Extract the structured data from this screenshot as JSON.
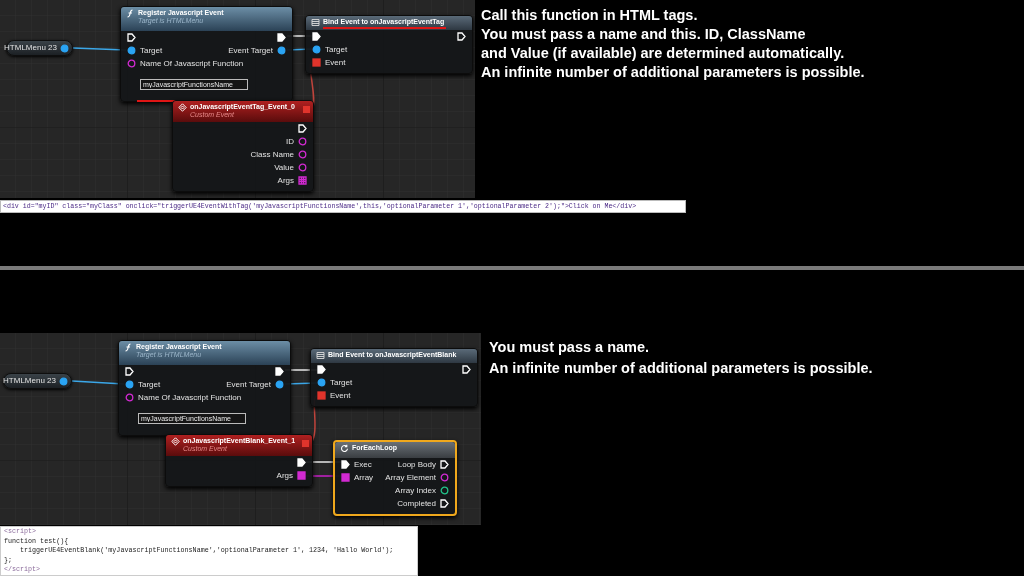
{
  "sections": [
    {
      "graph": {
        "nodes": [
          {
            "kind": "variable",
            "title": "HTMLMenu 23"
          },
          {
            "kind": "function",
            "title": "Register Javascript Event",
            "subtitle": "Target is HTMLMenu",
            "rows": [
              {
                "in": {
                  "kind": "exec",
                  "connected": false
                },
                "out": {
                  "kind": "exec",
                  "connected": true
                }
              },
              {
                "in": {
                  "kind": "object",
                  "label": "Target",
                  "connected": true
                },
                "out": {
                  "kind": "object",
                  "label": "Event Target",
                  "connected": true
                }
              },
              {
                "in": {
                  "kind": "string",
                  "label": "Name Of Javascript Function",
                  "connected": false,
                  "value": "myJavascriptFunctionsName",
                  "highlighted": true
                }
              }
            ]
          },
          {
            "kind": "bind",
            "title": "Bind Event to onJavascriptEventTag",
            "highlighted": true,
            "rows": [
              {
                "in": {
                  "kind": "exec",
                  "connected": true
                },
                "out": {
                  "kind": "exec",
                  "connected": false
                }
              },
              {
                "in": {
                  "kind": "object",
                  "label": "Target",
                  "connected": true
                }
              },
              {
                "in": {
                  "kind": "delegate",
                  "label": "Event",
                  "connected": true
                }
              }
            ]
          },
          {
            "kind": "event",
            "title": "onJavascriptEventTag_Event_0",
            "subtitle": "Custom Event",
            "rows": [
              {
                "out": {
                  "kind": "exec",
                  "connected": false
                }
              },
              {
                "out": {
                  "kind": "string",
                  "label": "ID",
                  "connected": false
                }
              },
              {
                "out": {
                  "kind": "string",
                  "label": "Class Name",
                  "connected": false
                }
              },
              {
                "out": {
                  "kind": "string",
                  "label": "Value",
                  "connected": false
                }
              },
              {
                "out": {
                  "kind": "array",
                  "label": "Args",
                  "connected": false
                }
              }
            ]
          }
        ]
      },
      "code": {
        "kind": "inline",
        "lines": [
          "<div id=\"myID\" class=\"myClass\" onclick=\"triggerUE4EventWithTag('myJavascriptFunctionsName',this,'optionalParameter 1','optionalParameter 2');\">Click on Me</div>"
        ]
      },
      "notes": [
        "Call this function in HTML tags.",
        "You must pass a name and this. ID, ClassName",
        "and Value (if available) are determined automatically.",
        "An infinite number of additional parameters is possible."
      ]
    },
    {
      "graph": {
        "nodes": [
          {
            "kind": "variable",
            "title": "HTMLMenu 23"
          },
          {
            "kind": "function",
            "title": "Register Javascript Event",
            "subtitle": "Target is HTMLMenu",
            "rows": [
              {
                "in": {
                  "kind": "exec",
                  "connected": false
                },
                "out": {
                  "kind": "exec",
                  "connected": true
                }
              },
              {
                "in": {
                  "kind": "object",
                  "label": "Target",
                  "connected": true
                },
                "out": {
                  "kind": "object",
                  "label": "Event Target",
                  "connected": true
                }
              },
              {
                "in": {
                  "kind": "string",
                  "label": "Name Of Javascript Function",
                  "connected": false,
                  "value": "myJavascriptFunctionsName"
                }
              }
            ]
          },
          {
            "kind": "bind",
            "title": "Bind Event to onJavascriptEventBlank",
            "rows": [
              {
                "in": {
                  "kind": "exec",
                  "connected": true
                },
                "out": {
                  "kind": "exec",
                  "connected": false
                }
              },
              {
                "in": {
                  "kind": "object",
                  "label": "Target",
                  "connected": true
                }
              },
              {
                "in": {
                  "kind": "delegate",
                  "label": "Event",
                  "connected": true
                }
              }
            ]
          },
          {
            "kind": "event",
            "title": "onJavascriptEventBlank_Event_1",
            "subtitle": "Custom Event",
            "rows": [
              {
                "out": {
                  "kind": "exec",
                  "connected": true
                }
              },
              {
                "out": {
                  "kind": "array",
                  "label": "Args",
                  "connected": true
                }
              }
            ]
          },
          {
            "kind": "loop",
            "title": "ForEachLoop",
            "selected": true,
            "rows": [
              {
                "in": {
                  "kind": "exec",
                  "label": "Exec",
                  "connected": true
                },
                "out": {
                  "kind": "exec",
                  "label": "Loop Body",
                  "connected": false
                }
              },
              {
                "in": {
                  "kind": "array",
                  "label": "Array",
                  "connected": true
                },
                "out": {
                  "kind": "string",
                  "label": "Array Element",
                  "connected": false
                }
              },
              {
                "out": {
                  "kind": "int",
                  "label": "Array Index",
                  "connected": false
                }
              },
              {
                "out": {
                  "kind": "exec",
                  "label": "Completed",
                  "connected": false
                }
              }
            ]
          }
        ]
      },
      "code": {
        "kind": "block",
        "lines": [
          "<script>",
          "function test(){",
          "    triggerUE4EventBlank('myJavascriptFunctionsName','optionalParameter 1', 1234, 'Hallo World');",
          "};",
          "</script>"
        ]
      },
      "notes": [
        "You must pass a name.",
        "An infinite number of additional parameters is possible."
      ]
    }
  ]
}
